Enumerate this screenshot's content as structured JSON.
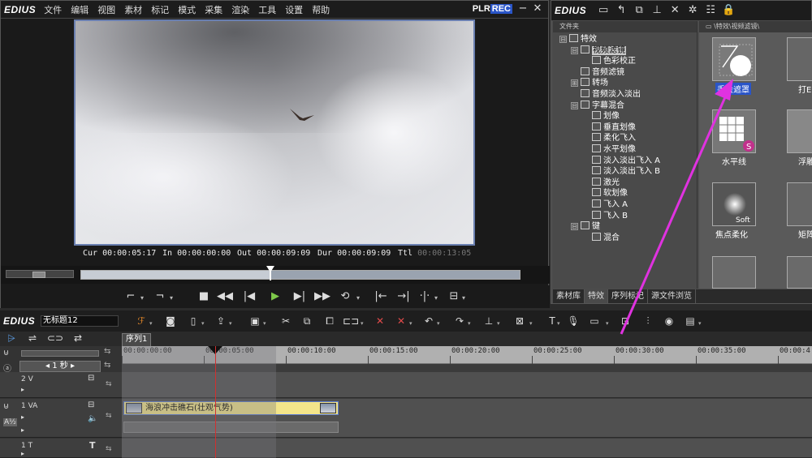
{
  "app": {
    "logo": "EDIUS",
    "menu": [
      "文件",
      "编辑",
      "视图",
      "素材",
      "标记",
      "模式",
      "采集",
      "渲染",
      "工具",
      "设置",
      "帮助"
    ],
    "plr": "PLR",
    "rec": "REC"
  },
  "player": {
    "timecodes": {
      "cur_label": "Cur",
      "cur": "00:00:05:17",
      "in_label": "In",
      "in": "00:00:00:00",
      "out_label": "Out",
      "out": "00:00:09:09",
      "dur_label": "Dur",
      "dur": "00:00:09:09",
      "ttl_label": "Ttl",
      "ttl": "00:00:13:05"
    }
  },
  "library": {
    "logo": "EDIUS",
    "tree_header": "文件夹",
    "grid_header": "\\特效\\视频滤镜\\",
    "tree": [
      {
        "label": "特效",
        "level": 0,
        "expander": "⊟",
        "selected": false
      },
      {
        "label": "视频滤镜",
        "level": 1,
        "expander": "⊟",
        "selected": true
      },
      {
        "label": "色彩校正",
        "level": 2,
        "expander": "",
        "selected": false
      },
      {
        "label": "音频滤镜",
        "level": 1,
        "expander": "",
        "selected": false
      },
      {
        "label": "转场",
        "level": 1,
        "expander": "⊞",
        "selected": false
      },
      {
        "label": "音频淡入淡出",
        "level": 1,
        "expander": "",
        "selected": false
      },
      {
        "label": "字幕混合",
        "level": 1,
        "expander": "⊟",
        "selected": false
      },
      {
        "label": "划像",
        "level": 2,
        "expander": "",
        "selected": false
      },
      {
        "label": "垂直划像",
        "level": 2,
        "expander": "",
        "selected": false
      },
      {
        "label": "柔化飞入",
        "level": 2,
        "expander": "",
        "selected": false
      },
      {
        "label": "水平划像",
        "level": 2,
        "expander": "",
        "selected": false
      },
      {
        "label": "淡入淡出飞入 A",
        "level": 2,
        "expander": "",
        "selected": false
      },
      {
        "label": "淡入淡出飞入 B",
        "level": 2,
        "expander": "",
        "selected": false
      },
      {
        "label": "激光",
        "level": 2,
        "expander": "",
        "selected": false
      },
      {
        "label": "软划像",
        "level": 2,
        "expander": "",
        "selected": false
      },
      {
        "label": "飞入 A",
        "level": 2,
        "expander": "",
        "selected": false
      },
      {
        "label": "飞入 B",
        "level": 2,
        "expander": "",
        "selected": false
      },
      {
        "label": "键",
        "level": 1,
        "expander": "⊟",
        "selected": false
      },
      {
        "label": "混合",
        "level": 2,
        "expander": "",
        "selected": false
      }
    ],
    "effects": [
      {
        "label": "手绘遮罩",
        "selected": true
      },
      {
        "label": "打E",
        "selected": false
      },
      {
        "label": "水平线",
        "selected": false
      },
      {
        "label": "浮雕",
        "selected": false
      },
      {
        "label": "焦点柔化",
        "selected": false
      },
      {
        "label": "矩阵",
        "selected": false
      }
    ],
    "tabs": [
      "素材库",
      "特效",
      "序列标记",
      "源文件浏览"
    ],
    "soft_label": "Soft"
  },
  "timeline": {
    "logo": "EDIUS",
    "project_name": "无标题12",
    "sequence_tab": "序列1",
    "scale_label": "1 秒",
    "ruler": [
      "00:00:00:00",
      "00:00:05:00",
      "00:00:10:00",
      "00:00:15:00",
      "00:00:20:00",
      "00:00:25:00",
      "00:00:30:00",
      "00:00:35:00",
      "00:00:4"
    ],
    "tracks": [
      {
        "id": "2 V"
      },
      {
        "id": "1 VA",
        "clip": "海浪冲击礁石(壮观气势)"
      },
      {
        "id": "1 T"
      }
    ]
  },
  "colors": {
    "accent_blue": "#2a55c8",
    "clip_yellow": "#f3e58a",
    "arrow_magenta": "#e032e0",
    "play_green": "#7ec84a",
    "playhead_red": "#d03030"
  }
}
